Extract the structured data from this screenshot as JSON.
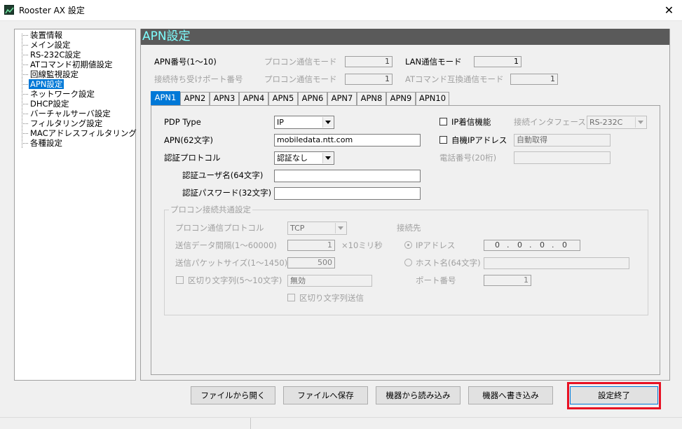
{
  "window": {
    "title": "Rooster AX 設定",
    "close_glyph": "✕",
    "icon": "app-icon"
  },
  "tree": {
    "selected": "APN設定",
    "items": [
      "装置情報",
      "メイン設定",
      "RS-232C設定",
      "ATコマンド初期値設定",
      "回線監視設定",
      "APN設定",
      "ネットワーク設定",
      "DHCP設定",
      "バーチャルサーバ設定",
      "フィルタリング設定",
      "MACアドレスフィルタリング",
      "各種設定"
    ]
  },
  "section": {
    "title": "APN設定"
  },
  "header_fields": {
    "apn_no_label": "APN番号(1～10)",
    "procon_mode_label": "プロコン通信モード",
    "procon_mode_value": "1",
    "lan_mode_label": "LAN通信モード",
    "lan_mode_value": "1",
    "listen_port_label": "接続待ち受けポート番号",
    "procon_mode2_label": "プロコン通信モード",
    "procon_mode2_value": "1",
    "at_mode_label": "ATコマンド互換通信モード",
    "at_mode_value": "1"
  },
  "tabs": [
    "APN1",
    "APN2",
    "APN3",
    "APN4",
    "APN5",
    "APN6",
    "APN7",
    "APN8",
    "APN9",
    "APN10"
  ],
  "active_tab": "APN1",
  "apn": {
    "pdp_type_label": "PDP Type",
    "pdp_type_value": "IP",
    "apn_label": "APN(62文字)",
    "apn_value": "mobiledata.ntt.com",
    "auth_label": "認証プロトコル",
    "auth_value": "認証なし",
    "user_label": "認証ユーザ名(64文字)",
    "user_value": "",
    "password_label": "認証パスワード(32文字)",
    "password_value": "",
    "ip_incoming_label": "IP着信機能",
    "interface_label": "接続インタフェース",
    "interface_value": "RS-232C",
    "auto_ip_label": "自機IPアドレス",
    "auto_ip_value": "自動取得",
    "phone_label": "電話番号(20桁)",
    "phone_value": ""
  },
  "procon_group": {
    "title": "プロコン接続共通設定",
    "protocol_label": "プロコン通信プロトコル",
    "protocol_value": "TCP",
    "interval_label": "送信データ間隔(1～60000)",
    "interval_value": "1",
    "interval_unit": "×10ミリ秒",
    "packet_label": "送信パケットサイズ(1～1450)",
    "packet_value": "500",
    "delimiter_label": "区切り文字列(5～10文字)",
    "delimiter_value": "無効",
    "delimiter_send_label": "区切り文字列送信",
    "dest_label": "接続先",
    "ip_label": "IPアドレス",
    "ip_octets": [
      "0",
      "0",
      "0",
      "0"
    ],
    "ip_dot": ".",
    "host_label": "ホスト名(64文字)",
    "host_value": "",
    "port_label": "ポート番号",
    "port_value": "1"
  },
  "buttons": {
    "open_file": "ファイルから開く",
    "save_file": "ファイルへ保存",
    "read_device": "機器から読み込み",
    "write_device": "機器へ書き込み",
    "finish": "設定終了"
  },
  "colors": {
    "selection": "#0078d7",
    "section_header_bg": "#5a5a5a",
    "section_header_fg": "#7fffff",
    "highlight": "#e81123"
  }
}
